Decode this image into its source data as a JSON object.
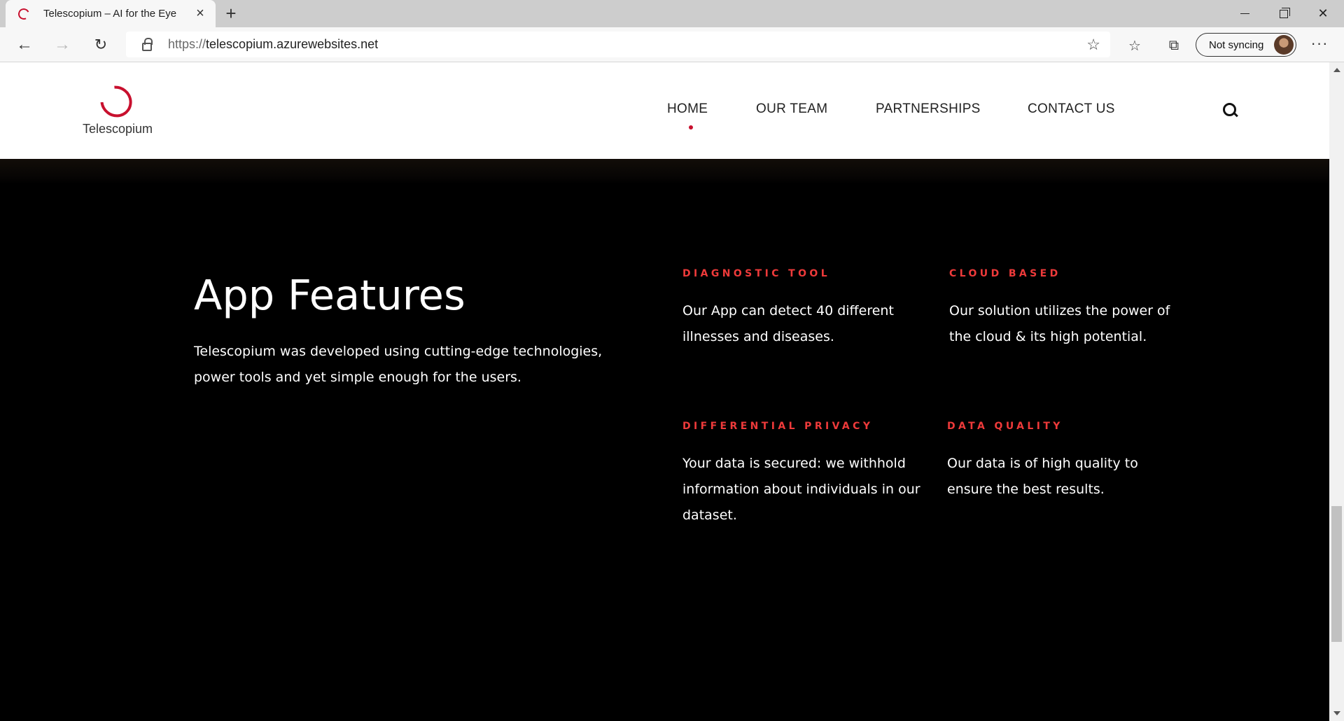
{
  "browser": {
    "tab_title": "Telescopium – AI for the Eye",
    "url_protocol": "https://",
    "url_host": "telescopium.azurewebsites.net",
    "profile_label": "Not syncing"
  },
  "site": {
    "logo_text": "Telescopium",
    "brand_color": "#c8102e",
    "nav": {
      "home": "HOME",
      "team": "OUR TEAM",
      "partnerships": "PARTNERSHIPS",
      "contact": "CONTACT US",
      "active": "HOME"
    }
  },
  "features": {
    "title": "App Features",
    "intro": "Telescopium was developed using cutting-edge technologies, power tools and yet simple enough for the users.",
    "accent_color": "#ee3a3a",
    "items": [
      {
        "heading": "DIAGNOSTIC TOOL",
        "body": "Our App can detect 40 different illnesses and diseases."
      },
      {
        "heading": "CLOUD BASED",
        "body": "Our solution utilizes the power of the cloud & its high potential."
      },
      {
        "heading": "DIFFERENTIAL PRIVACY",
        "body": "Your data is secured: we withhold information about individuals in our dataset."
      },
      {
        "heading": "DATA QUALITY",
        "body": "Our data is of high quality to ensure the best results."
      }
    ]
  },
  "icons": [
    "favicon-icon",
    "close-icon",
    "plus-icon",
    "back-arrow-icon",
    "forward-arrow-icon",
    "reload-icon",
    "lock-icon",
    "star-icon",
    "favorites-icon",
    "collections-icon",
    "avatar",
    "more-icon",
    "search-icon"
  ]
}
